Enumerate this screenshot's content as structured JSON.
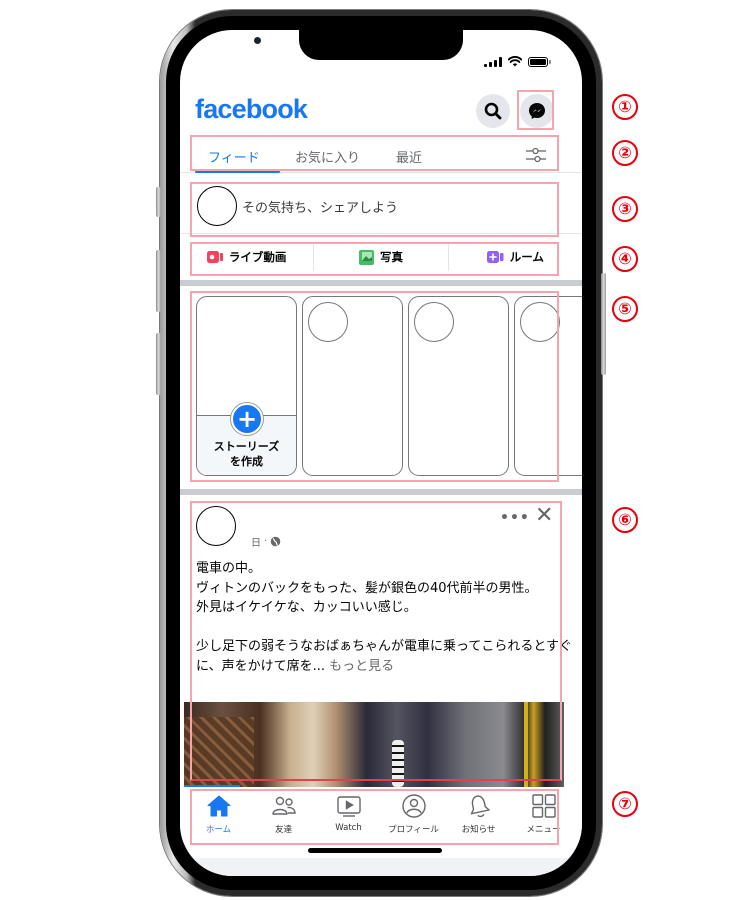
{
  "app": {
    "logo": "facebook",
    "brand_color": "#1877f2"
  },
  "status_bar": {
    "signal": "signal-icon",
    "wifi": "wifi-icon",
    "battery": "battery-icon"
  },
  "header": {
    "search_icon": "search-icon",
    "messenger_icon": "messenger-icon"
  },
  "tabs": [
    {
      "label": "フィード",
      "active": true
    },
    {
      "label": "お気に入り",
      "active": false
    },
    {
      "label": "最近",
      "active": false
    }
  ],
  "composer": {
    "placeholder": "その気持ち、シェアしよう"
  },
  "actions": [
    {
      "label": "ライブ動画",
      "icon": "live-video-icon",
      "color": "#f3425f"
    },
    {
      "label": "写真",
      "icon": "photo-icon",
      "color": "#45bd62"
    },
    {
      "label": "ルーム",
      "icon": "room-icon",
      "color": "#9360f7"
    }
  ],
  "stories": {
    "create_label_line1": "ストーリーズ",
    "create_label_line2": "を作成",
    "count_visible": 4
  },
  "post": {
    "time": "日",
    "separator": "·",
    "privacy_icon": "globe-icon",
    "more_label": "•••",
    "close_label": "✕",
    "lines": [
      "電車の中。",
      "ヴィトンのバックをもった、髪が銀色の40代前半の男性。",
      "外見はイケイケな、カッコいい感じ。",
      "",
      "少し足下の弱そうなおばぁちゃんが電車に乗ってこられるとすぐに、声をかけて席を..."
    ],
    "see_more": "もっと見る"
  },
  "bottom_nav": [
    {
      "label": "ホーム",
      "icon": "home-icon",
      "active": true
    },
    {
      "label": "友達",
      "icon": "friends-icon",
      "active": false
    },
    {
      "label": "Watch",
      "icon": "watch-icon",
      "active": false
    },
    {
      "label": "プロフィール",
      "icon": "profile-icon",
      "active": false
    },
    {
      "label": "お知らせ",
      "icon": "bell-icon",
      "active": false
    },
    {
      "label": "メニュー",
      "icon": "menu-grid-icon",
      "active": false
    }
  ],
  "annotations": [
    "①",
    "②",
    "③",
    "④",
    "⑤",
    "⑥",
    "⑦"
  ]
}
